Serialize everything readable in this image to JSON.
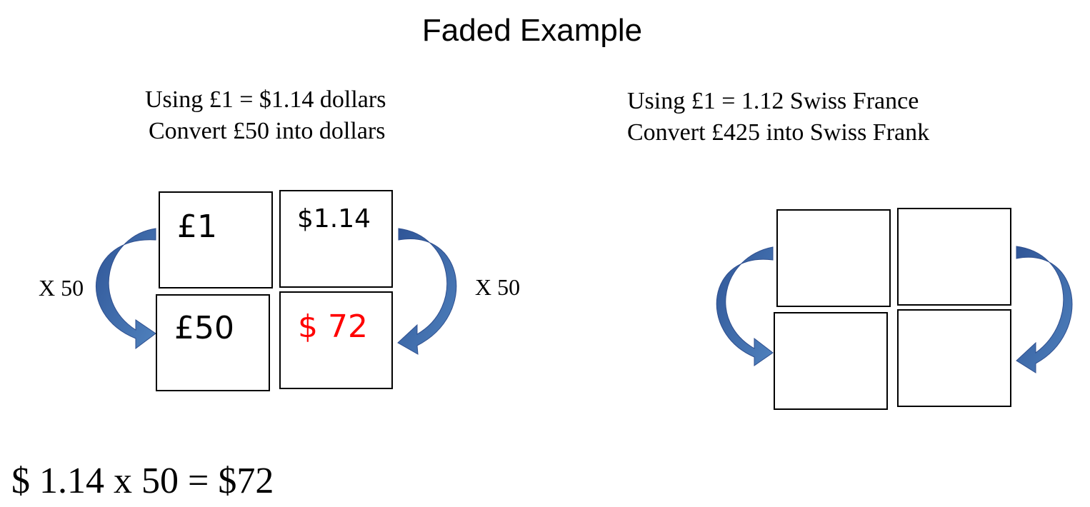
{
  "title": "Faded Example",
  "left_problem": {
    "line1": "Using £1 = $1.14 dollars",
    "line2": "Convert £50 into dollars",
    "grid": {
      "top_left": "£1",
      "top_right": "$1.14",
      "bottom_left": "£50",
      "bottom_right": "$ 72"
    },
    "left_multiplier": "X 50",
    "right_multiplier": "X 50",
    "answer_color": "#ff0000",
    "arrow_color": "#4472c4"
  },
  "right_problem": {
    "line1": "Using £1 = 1.12 Swiss France",
    "line2": "Convert £425 into Swiss Frank"
  },
  "working": "$ 1.14 x 50 = $72"
}
